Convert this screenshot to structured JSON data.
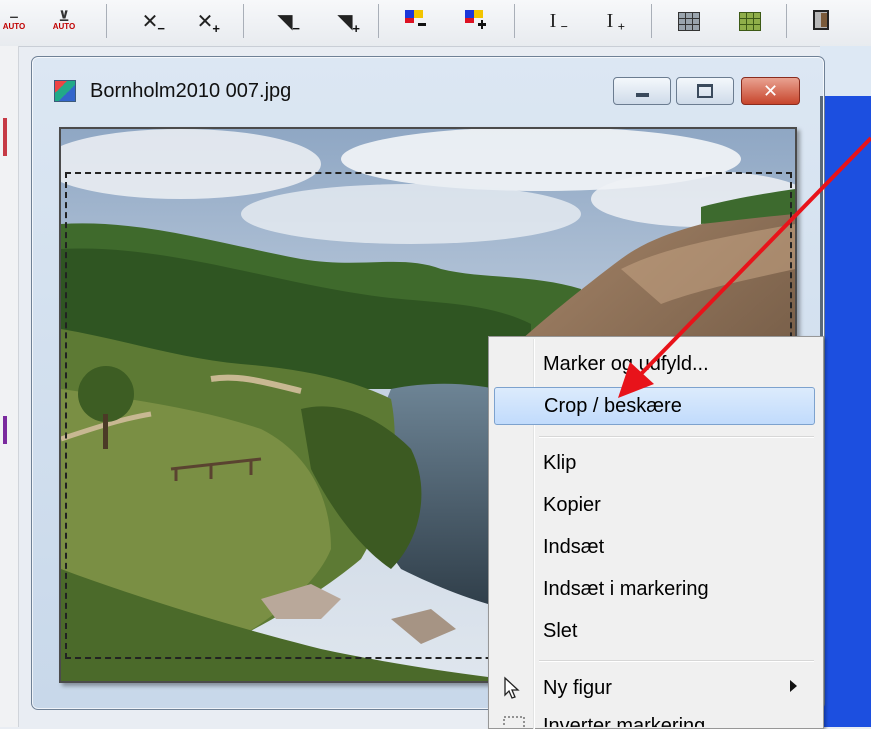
{
  "toolbar": {
    "auto_left": "AUTO",
    "auto_right": "AUTO",
    "minus": "−",
    "plus": "+",
    "text_cursor": "I"
  },
  "window": {
    "title": "Bornholm2010 007.jpg",
    "close_glyph": "✕"
  },
  "context_menu": {
    "items": [
      "Marker og udfyld...",
      "Crop / beskære",
      "Klip",
      "Kopier",
      "Indsæt",
      "Indsæt i markering",
      "Slet",
      "Ny figur",
      "Inverter markering"
    ]
  },
  "colors": {
    "workspace_blue": "#1c4fe0",
    "menu_highlight": "#c1dbfc",
    "annotation_red": "#e8131a"
  },
  "icons": [
    "auto-level-icon",
    "zoom-out-icon",
    "zoom-in-icon",
    "brightness-down-icon",
    "brightness-up-icon",
    "color-down-icon",
    "color-up-icon",
    "text-smaller-icon",
    "text-larger-icon",
    "grid-icon",
    "grid-green-icon",
    "layer-icon",
    "cursor-icon",
    "selection-icon"
  ]
}
